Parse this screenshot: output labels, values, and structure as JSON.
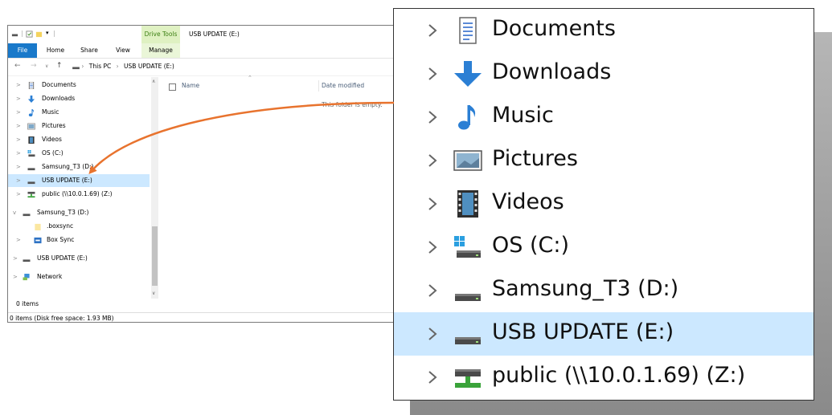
{
  "window": {
    "title": "USB UPDATE (E:)",
    "context_tab": "Drive Tools",
    "ribbon_tabs": [
      "File",
      "Home",
      "Share",
      "View",
      "Manage"
    ],
    "breadcrumb": [
      "This PC",
      "USB UPDATE (E:)"
    ],
    "columns": {
      "name": "Name",
      "date": "Date modified"
    },
    "empty_message": "This folder is empty.",
    "status_items": "0 items",
    "status_bar": "0 items (Disk free space: 1.93 MB)"
  },
  "nav": [
    {
      "label": "Documents",
      "icon": "documents-icon",
      "expand": ">"
    },
    {
      "label": "Downloads",
      "icon": "downloads-icon",
      "expand": ">"
    },
    {
      "label": "Music",
      "icon": "music-icon",
      "expand": ">"
    },
    {
      "label": "Pictures",
      "icon": "pictures-icon",
      "expand": ">"
    },
    {
      "label": "Videos",
      "icon": "videos-icon",
      "expand": ">"
    },
    {
      "label": "OS (C:)",
      "icon": "os-drive-icon",
      "expand": ">"
    },
    {
      "label": "Samsung_T3 (D:)",
      "icon": "drive-icon",
      "expand": ">"
    },
    {
      "label": "USB UPDATE (E:)",
      "icon": "drive-icon",
      "expand": ">",
      "selected": true
    },
    {
      "label": "public (\\\\10.0.1.69) (Z:)",
      "icon": "network-drive-icon",
      "expand": ">"
    },
    {
      "label": "Samsung_T3 (D:)",
      "icon": "drive-icon",
      "expand": "v"
    },
    {
      "label": ".boxsync",
      "icon": "folder-icon",
      "expand": ""
    },
    {
      "label": "Box Sync",
      "icon": "box-sync-icon",
      "expand": ">"
    },
    {
      "label": "USB UPDATE (E:)",
      "icon": "drive-icon",
      "expand": ">"
    },
    {
      "label": "Network",
      "icon": "network-icon",
      "expand": ">"
    }
  ],
  "zoom_items": [
    {
      "label": "Documents",
      "icon": "documents-icon"
    },
    {
      "label": "Downloads",
      "icon": "downloads-icon"
    },
    {
      "label": "Music",
      "icon": "music-icon"
    },
    {
      "label": "Pictures",
      "icon": "pictures-icon"
    },
    {
      "label": "Videos",
      "icon": "videos-icon"
    },
    {
      "label": "OS (C:)",
      "icon": "os-drive-icon"
    },
    {
      "label": "Samsung_T3 (D:)",
      "icon": "drive-icon"
    },
    {
      "label": "USB UPDATE (E:)",
      "icon": "drive-icon",
      "selected": true
    },
    {
      "label": "public (\\\\10.0.1.69) (Z:)",
      "icon": "network-drive-icon"
    }
  ],
  "colors": {
    "selection": "#cce8ff",
    "file_tab": "#1979ca",
    "context_tab": "#dff1c2",
    "arrow": "#e8732e",
    "accent_blue": "#2b7fd4"
  }
}
